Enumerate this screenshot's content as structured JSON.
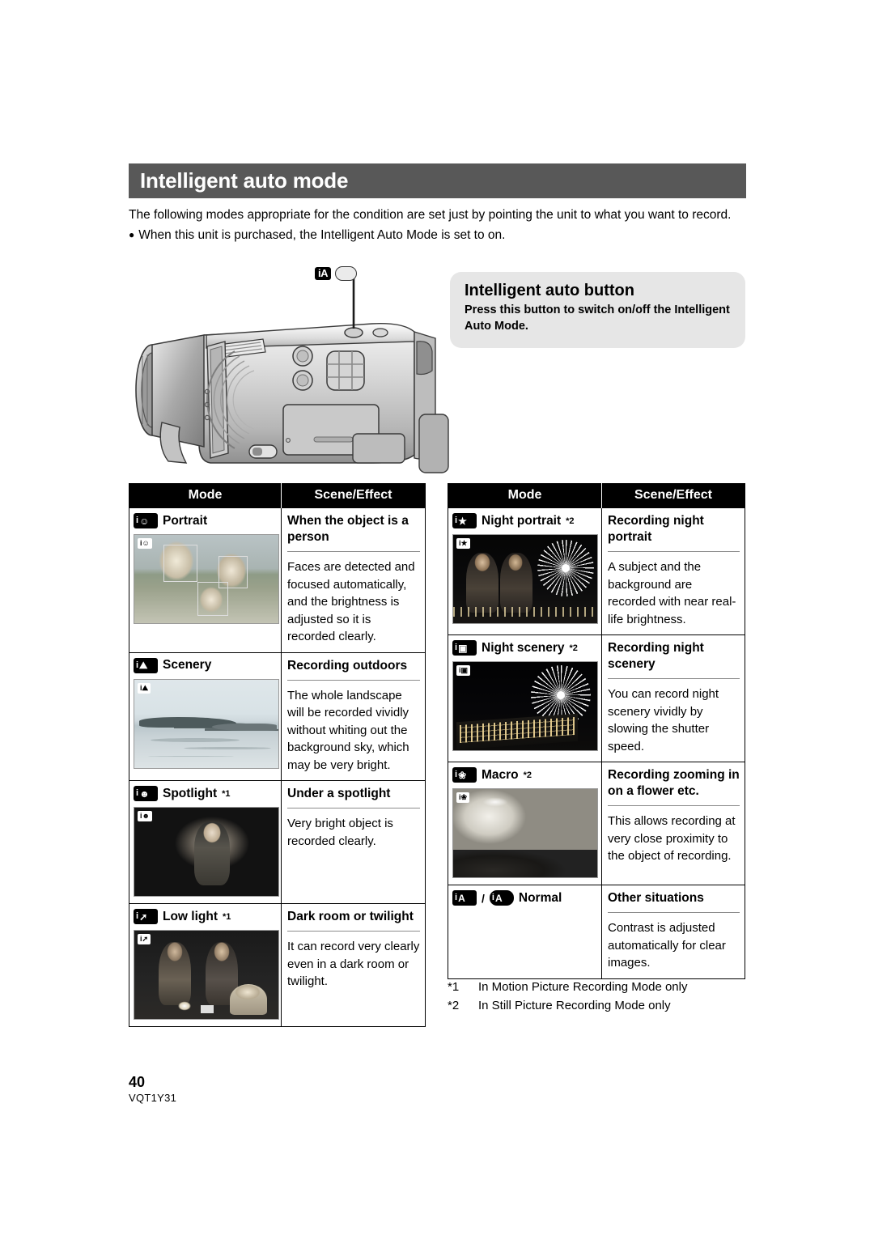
{
  "page": {
    "title": "Intelligent auto mode",
    "intro_paragraph": "The following modes appropriate for the condition are set just by pointing the unit to what you want to record.",
    "intro_bullet": "When this unit is purchased, the Intelligent Auto Mode is set to on.",
    "bullet_glyph": "●",
    "page_number": "40",
    "doc_code": "VQT1Y31"
  },
  "callout": {
    "title": "Intelligent auto button",
    "body": "Press this button to switch on/off the Intelligent Auto Mode."
  },
  "illustration": {
    "badge_label": "iA",
    "button_name": "intelligent-auto-button"
  },
  "table_headers": {
    "mode": "Mode",
    "scene_effect": "Scene/Effect"
  },
  "left_table": [
    {
      "mode_label": "Portrait",
      "sup": "",
      "icon": "portrait-icon",
      "osd": "i",
      "scene_title": "When the object is a person",
      "scene_body": "Faces are detected and focused automatically, and the brightness is adjusted so it is recorded clearly."
    },
    {
      "mode_label": "Scenery",
      "sup": "",
      "icon": "scenery-icon",
      "osd": "i",
      "scene_title": "Recording outdoors",
      "scene_body": "The whole landscape will be recorded vividly without whiting out the background sky, which may be very bright."
    },
    {
      "mode_label": "Spotlight",
      "sup": "*1",
      "icon": "spotlight-icon",
      "osd": "i",
      "scene_title": "Under a spotlight",
      "scene_body": "Very bright object is recorded clearly."
    },
    {
      "mode_label": "Low light",
      "sup": "*1",
      "icon": "low-light-icon",
      "osd": "i",
      "scene_title": "Dark room or twilight",
      "scene_body": "It can record very clearly even in a dark room or twilight."
    }
  ],
  "right_table": [
    {
      "mode_label": "Night portrait",
      "sup": "*2",
      "icon": "night-portrait-icon",
      "osd": "i",
      "scene_title": "Recording night portrait",
      "scene_body": "A subject and the background are recorded with near real-life brightness."
    },
    {
      "mode_label": "Night scenery",
      "sup": "*2",
      "icon": "night-scenery-icon",
      "osd": "i",
      "scene_title": "Recording night scenery",
      "scene_body": "You can record night scenery vividly by slowing the shutter speed."
    },
    {
      "mode_label": "Macro",
      "sup": "*2",
      "icon": "macro-icon",
      "osd": "i",
      "scene_title": "Recording zooming in on a flower etc.",
      "scene_body": "This allows recording at very close proximity to the object of recording."
    },
    {
      "mode_label": "Normal",
      "sup": "",
      "icon": "normal-ia-icon",
      "osd": "",
      "scene_title": "Other situations",
      "scene_body": "Contrast is adjusted automatically for clear images."
    }
  ],
  "footnotes": [
    {
      "mark": "*1",
      "text": "In Motion Picture Recording Mode only"
    },
    {
      "mark": "*2",
      "text": "In Still Picture Recording Mode only"
    }
  ],
  "icon_glyphs": {
    "portrait-icon": "☺",
    "scenery-icon": "⛰",
    "spotlight-icon": "☻",
    "low-light-icon": "↑",
    "night-portrait-icon": "★",
    "night-scenery-icon": "▒",
    "macro-icon": "❀",
    "normal-ia-icon": "A"
  },
  "colors": {
    "title_bar_bg": "#585858",
    "callout_bg": "#e6e6e6",
    "table_header_bg": "#000000",
    "rule_gray": "#8c8c8c"
  }
}
